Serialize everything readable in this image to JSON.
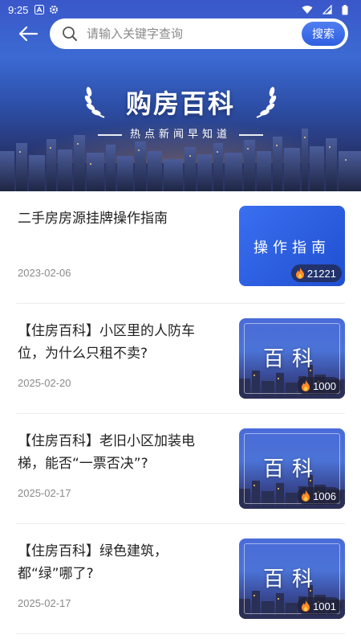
{
  "status_bar": {
    "time": "9:25"
  },
  "header": {
    "search_placeholder": "请输入关键字查询",
    "search_button": "搜索"
  },
  "hero": {
    "title": "购房百科",
    "subtitle": "热点新闻早知道"
  },
  "articles": [
    {
      "title": "二手房房源挂牌操作指南",
      "date": "2023-02-06",
      "thumb_text": "操作指南",
      "views": "21221"
    },
    {
      "title": "【住房百科】小区里的人防车位，为什么只租不卖?",
      "date": "2025-02-20",
      "thumb_text": "百科",
      "views": "1000"
    },
    {
      "title": "【住房百科】老旧小区加装电梯，能否“一票否决”?",
      "date": "2025-02-17",
      "thumb_text": "百科",
      "views": "1006"
    },
    {
      "title": "【住房百科】绿色建筑，都“绿”哪了?",
      "date": "2025-02-17",
      "thumb_text": "百科",
      "views": "1001"
    }
  ],
  "icons": {
    "back": "arrow-left-icon",
    "search": "search-icon",
    "views": "fire-icon"
  },
  "colors": {
    "accent": "#3a6ff0",
    "hero_top": "#3a57c9",
    "text": "#222222",
    "date": "#8a8a8a"
  }
}
